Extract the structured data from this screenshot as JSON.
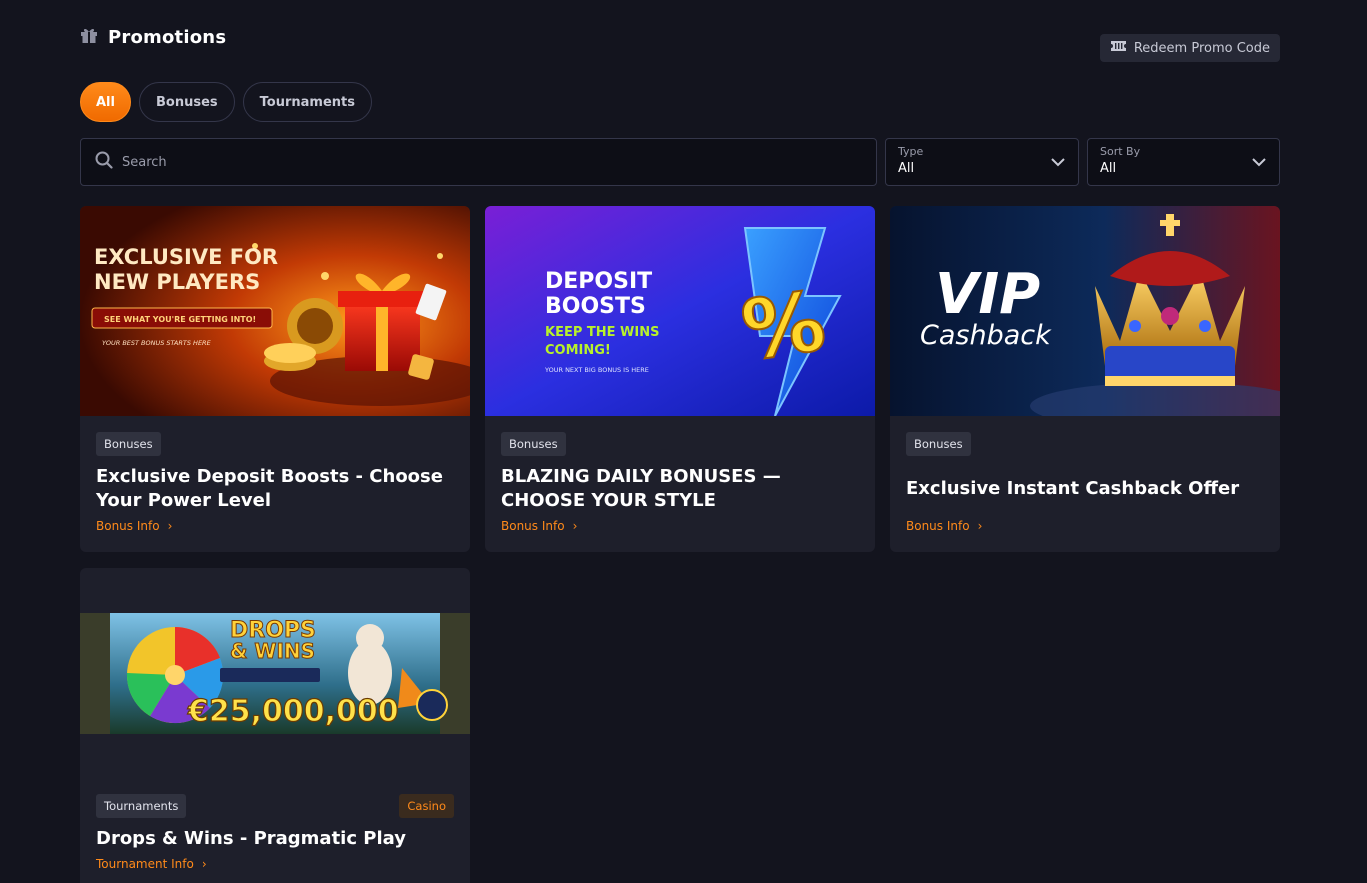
{
  "header": {
    "title": "Promotions",
    "redeem_label": "Redeem Promo Code"
  },
  "tabs": [
    {
      "label": "All",
      "active": true
    },
    {
      "label": "Bonuses",
      "active": false
    },
    {
      "label": "Tournaments",
      "active": false
    }
  ],
  "search": {
    "placeholder": "Search"
  },
  "filters": {
    "type": {
      "label": "Type",
      "value": "All"
    },
    "sort": {
      "label": "Sort By",
      "value": "All"
    }
  },
  "cards": [
    {
      "tag": "Bonuses",
      "title": "Exclusive Deposit Boosts - Choose Your Power Level",
      "link": "Bonus Info",
      "banner": {
        "line1": "EXCLUSIVE FOR",
        "line2": "NEW PLAYERS",
        "cta": "SEE WHAT YOU'RE GETTING INTO!",
        "sub": "YOUR BEST BONUS STARTS HERE"
      }
    },
    {
      "tag": "Bonuses",
      "title": "BLAZING DAILY BONUSES — CHOOSE YOUR STYLE",
      "link": "Bonus Info",
      "banner": {
        "line1": "DEPOSIT",
        "line2": "BOOSTS",
        "line3": "KEEP THE WINS",
        "line4": "COMING!",
        "sub": "YOUR NEXT BIG BONUS IS HERE",
        "symbol": "%"
      }
    },
    {
      "tag": "Bonuses",
      "title": "Exclusive Instant Cashback Offer",
      "link": "Bonus Info",
      "banner": {
        "line1": "VIP",
        "line2": "Cashback"
      }
    },
    {
      "tag": "Tournaments",
      "badge": "Casino",
      "title": "Drops & Wins - Pragmatic Play",
      "link": "Tournament Info",
      "banner": {
        "line1": "DROPS",
        "line2": "& WINS",
        "prize": "€25,000,000"
      }
    }
  ],
  "colors": {
    "accent": "#ff8a1a",
    "background": "#13141e",
    "card": "#1e1f2b"
  },
  "icons": [
    "gift-icon",
    "ticket-icon",
    "search-icon",
    "chevron-down-icon",
    "chevron-right-icon"
  ]
}
